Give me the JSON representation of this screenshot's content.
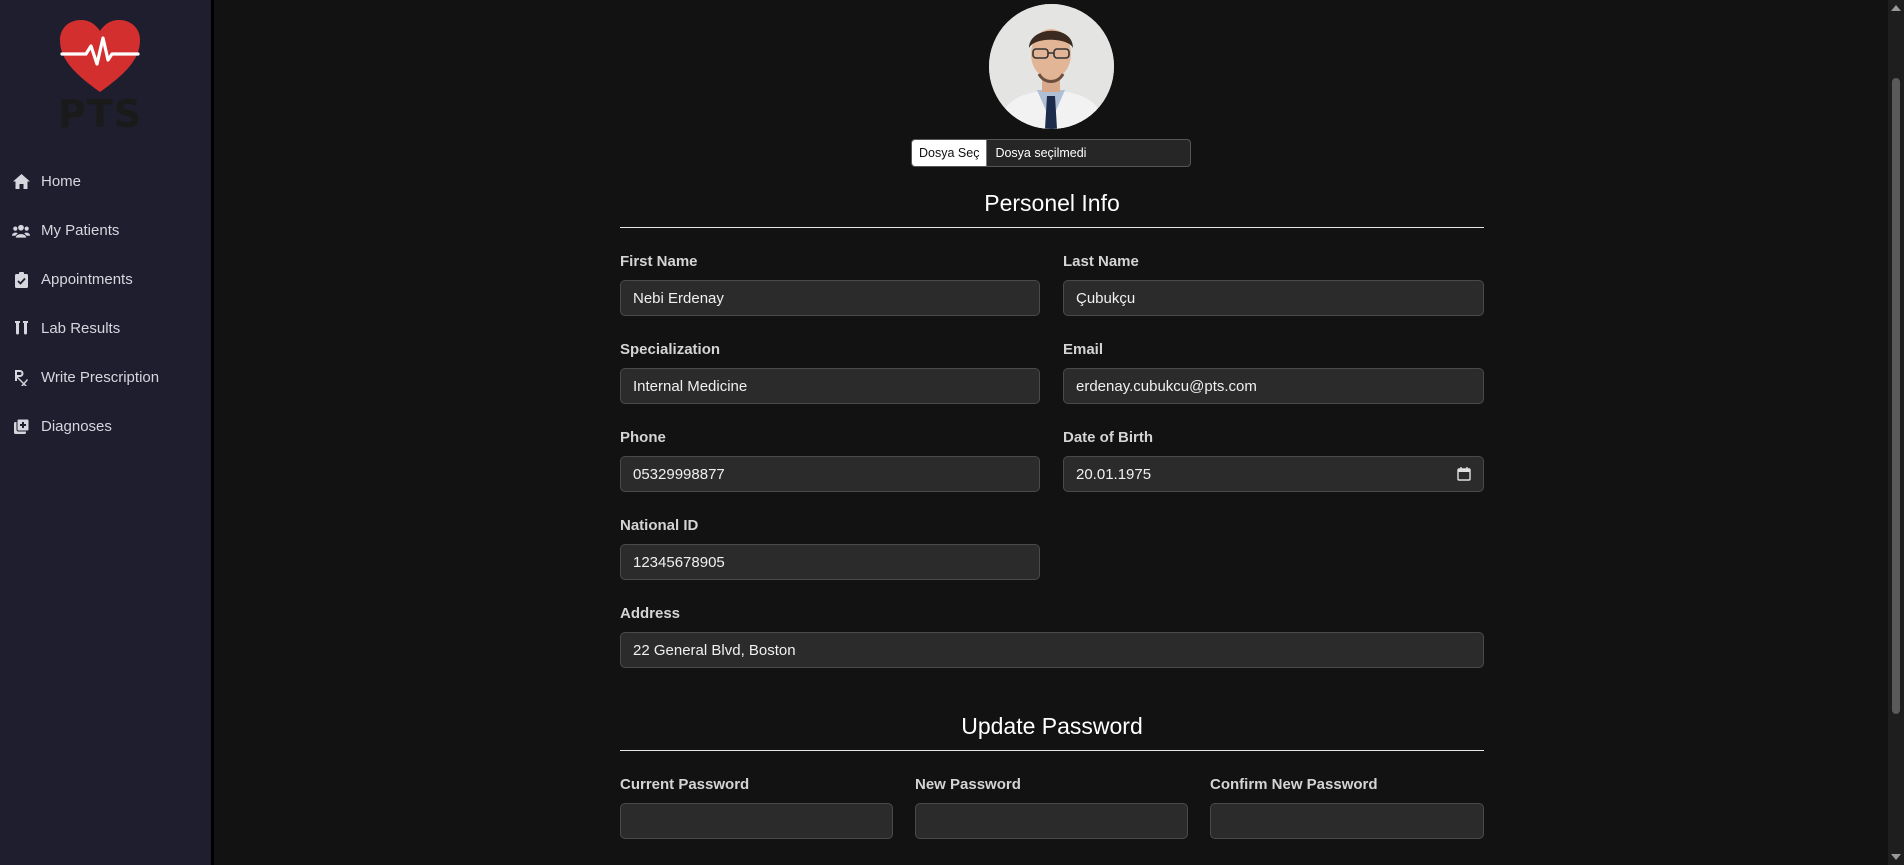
{
  "app": {
    "logo_text": "PTS"
  },
  "sidebar": {
    "items": [
      {
        "label": "Home",
        "icon": "home-icon"
      },
      {
        "label": "My Patients",
        "icon": "users-icon"
      },
      {
        "label": "Appointments",
        "icon": "clipboard-check-icon"
      },
      {
        "label": "Lab Results",
        "icon": "test-tubes-icon"
      },
      {
        "label": "Write Prescription",
        "icon": "prescription-icon"
      },
      {
        "label": "Diagnoses",
        "icon": "notes-medical-icon"
      }
    ]
  },
  "profile": {
    "file_button": "Dosya Seç",
    "file_status": "Dosya seçilmedi"
  },
  "personal_info": {
    "title": "Personel Info",
    "first_name_label": "First Name",
    "first_name": "Nebi Erdenay",
    "last_name_label": "Last Name",
    "last_name": "Çubukçu",
    "specialization_label": "Specialization",
    "specialization": "Internal Medicine",
    "email_label": "Email",
    "email": "erdenay.cubukcu@pts.com",
    "phone_label": "Phone",
    "phone": "05329998877",
    "dob_label": "Date of Birth",
    "dob": "20.01.1975",
    "national_id_label": "National ID",
    "national_id": "12345678905",
    "address_label": "Address",
    "address": "22 General Blvd, Boston"
  },
  "password": {
    "title": "Update Password",
    "current_label": "Current Password",
    "current_value": "",
    "new_label": "New Password",
    "new_value": "",
    "confirm_label": "Confirm New Password",
    "confirm_value": ""
  },
  "colors": {
    "sidebar_bg": "#1e1e2f",
    "page_bg": "#121212",
    "logo_red": "#d32f2f",
    "input_bg": "#2b2b2b"
  }
}
